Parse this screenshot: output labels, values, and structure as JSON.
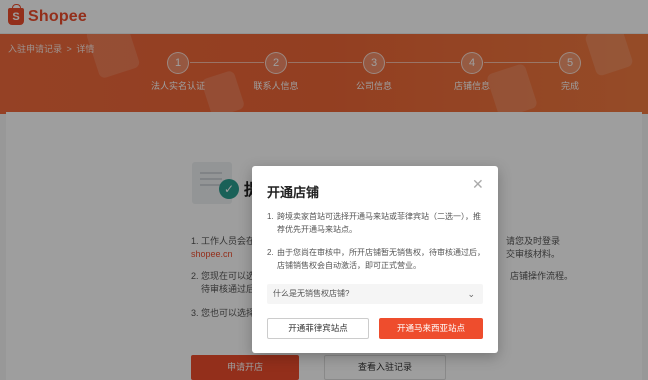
{
  "brand": {
    "name": "Shopee",
    "logo_letter": "S",
    "accent": "#ee4d2d"
  },
  "breadcrumb": [
    "入驻申请记录",
    ">",
    "详情"
  ],
  "steps": [
    {
      "num": "1",
      "label": "法人实名认证"
    },
    {
      "num": "2",
      "label": "联系人信息"
    },
    {
      "num": "3",
      "label": "公司信息"
    },
    {
      "num": "4",
      "label": "店铺信息"
    },
    {
      "num": "5",
      "label": "完成"
    }
  ],
  "background": {
    "heading_visible": "提",
    "item1_line1": "1. 工作人员会在",
    "item1_line2": "shopee.cn",
    "item1_right_line1": "请您及时登录",
    "item1_right_line2": "交审核材料。",
    "item2_line1": "2. 您现在可以选",
    "item2_line2": "待审核通过后",
    "item2_right": "店铺操作流程。",
    "item3_line1": "3. 您也可以选择",
    "apply_button": "申请开店",
    "records_button": "查看入驻记录"
  },
  "modal": {
    "title": "开通店铺",
    "close_icon": "close-icon",
    "note1_num": "1.",
    "note1_text": "跨境卖家首站可选择开通马来站或菲律宾站（二选一），推荐优先开通马来站点。",
    "note2_num": "2.",
    "note2_text": "由于您尚在审核中，所开店铺暂无销售权，待审核通过后，店铺销售权会自动激活，即可正式营业。",
    "faq_label": "什么是无销售权店铺?",
    "ph_button": "开通菲律宾站点",
    "my_button": "开通马来西亚站点"
  }
}
